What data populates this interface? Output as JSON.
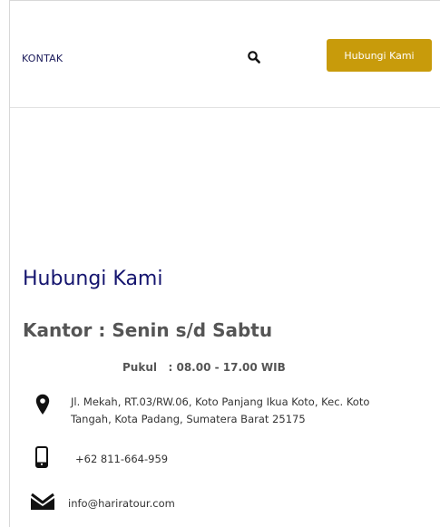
{
  "header": {
    "nav_link": "KONTAK",
    "cta_label": "Hubungi Kami"
  },
  "main": {
    "title": "Hubungi Kami",
    "office_heading": "Kantor : Senin s/d Sabtu",
    "office_hours": "Pukul   : 08.00 - 17.00 WIB",
    "contacts": {
      "address": "Jl. Mekah, RT.03/RW.06, Koto Panjang Ikua Koto, Kec. Koto Tangah, Kota Padang, Sumatera Barat 25175",
      "phone": "+62 811-664-959",
      "email": "info@hariratour.com"
    }
  },
  "icons": {
    "search": "search-icon",
    "address": "map-pin-icon",
    "phone": "smartphone-icon",
    "email": "envelope-icon"
  },
  "colors": {
    "cta_background": "#c89b0b",
    "title": "#14146e",
    "heading": "#555555"
  }
}
